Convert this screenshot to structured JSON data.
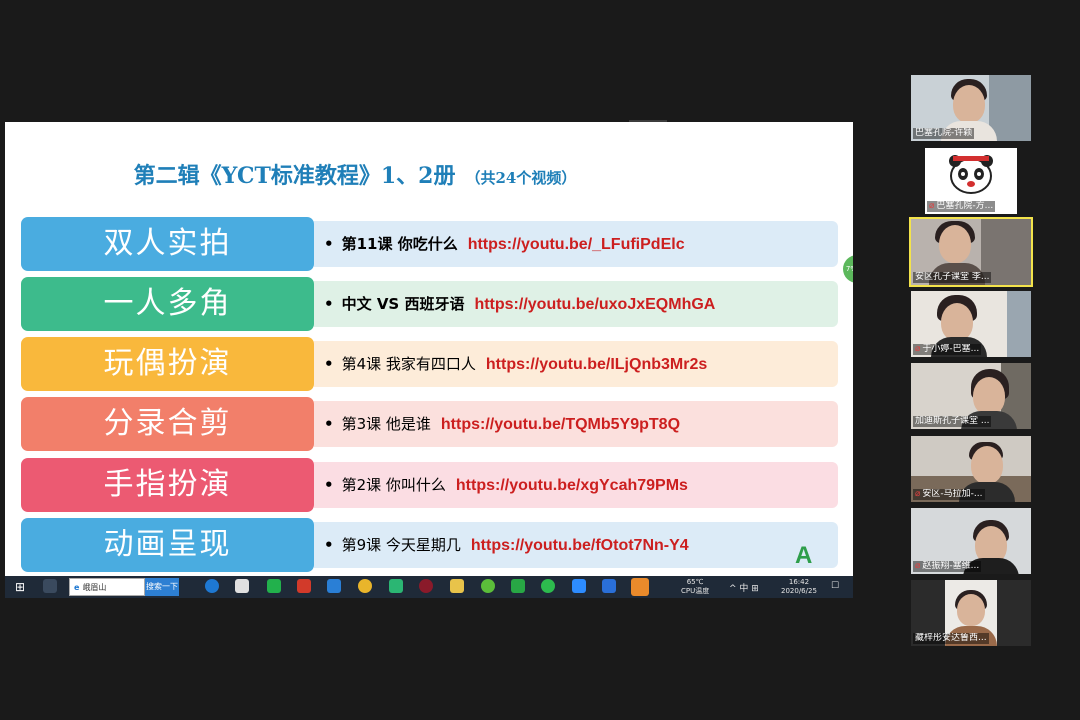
{
  "slide": {
    "title": "第二辑《YCT标准教程》1、2册",
    "subtitle": "（共24个视频）",
    "rows": [
      {
        "category": "双人实拍",
        "lesson": "第11课 你吃什么",
        "url": "https://youtu.be/_LFufiPdElc",
        "color": "#4aace0",
        "strip": "#dcebf7"
      },
      {
        "category": "一人多角",
        "lesson": "中文 VS 西班牙语",
        "url": "https://youtu.be/uxoJxEQMhGA",
        "color": "#3dbb8c",
        "strip": "#dff1e6"
      },
      {
        "category": "玩偶扮演",
        "lesson": "第4课 我家有四口人",
        "url": "https://youtu.be/ILjQnb3Mr2s",
        "color": "#f9b83c",
        "strip": "#fdecd9"
      },
      {
        "category": "分录合剪",
        "lesson": "第3课 他是谁",
        "url": "https://youtu.be/TQMb5Y9pT8Q",
        "color": "#f27f6a",
        "strip": "#fbe0dd"
      },
      {
        "category": "手指扮演",
        "lesson": "第2课 你叫什么",
        "url": "https://youtu.be/xgYcah79PMs",
        "color": "#ec5a72",
        "strip": "#fbdde3"
      },
      {
        "category": "动画呈现",
        "lesson": "第9课 今天星期几",
        "url": "https://youtu.be/fOtot7Nn-Y4",
        "color": "#4aace0",
        "strip": "#dcebf7"
      }
    ],
    "corner_logo": "A",
    "side_badge": "7%"
  },
  "taskbar": {
    "browser_text": "峨眉山",
    "search_button": "搜索一下",
    "temperature": "65℃",
    "temperature_label": "CPU温度",
    "tray": "^ 中 ⊞",
    "time": "16:42",
    "date": "2020/6/25",
    "notify": "☐"
  },
  "participants": [
    {
      "name": "巴塞孔院-许颖",
      "muted": false
    },
    {
      "name": "巴塞孔院-方...",
      "muted": true
    },
    {
      "name": "安区孔子课堂 李...",
      "muted": false
    },
    {
      "name": "于小婷-巴塞...",
      "muted": true
    },
    {
      "name": "加迪斯孔子课堂 ...",
      "muted": false
    },
    {
      "name": "安区-马拉加-...",
      "muted": true
    },
    {
      "name": "赵振翔-塞维...",
      "muted": true
    },
    {
      "name": "藏梓彤安达鲁西...",
      "muted": false
    }
  ]
}
